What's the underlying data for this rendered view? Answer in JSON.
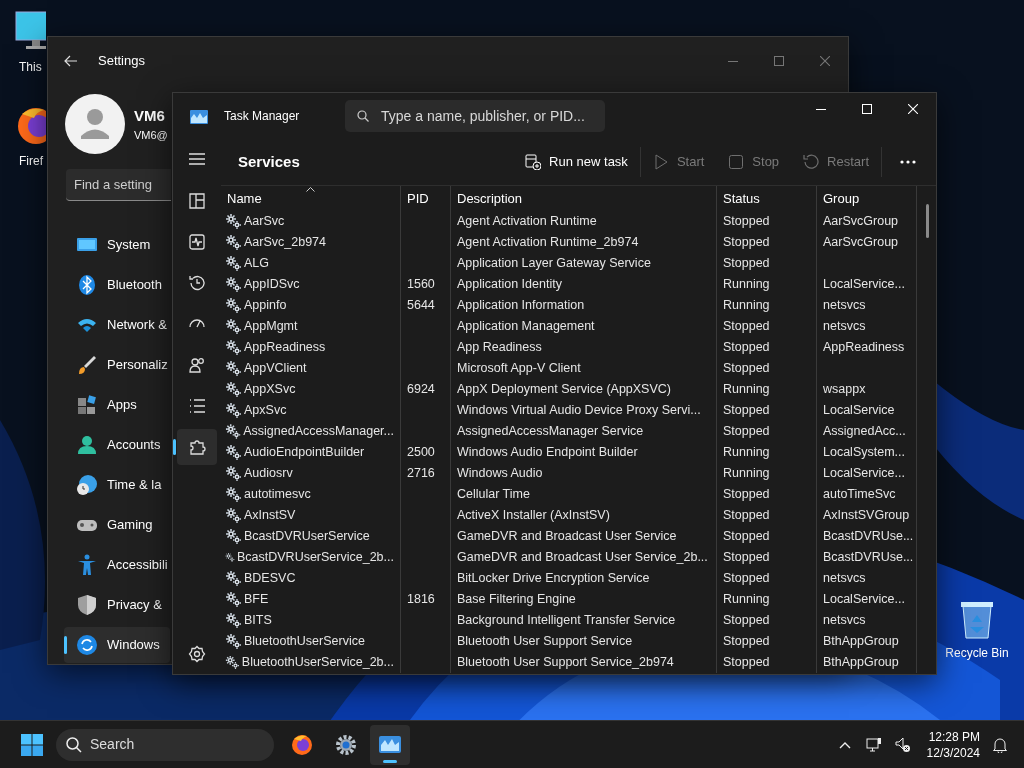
{
  "desktop_icons": [
    {
      "kind": "pc",
      "label": "This"
    },
    {
      "kind": "firefox",
      "label": "Firef"
    },
    {
      "kind": "recycle",
      "label": "Recycle Bin"
    }
  ],
  "settings": {
    "title": "Settings",
    "user": {
      "name": "VM6",
      "email": "VM6@"
    },
    "search": {
      "placeholder": "Find a setting"
    },
    "nav": [
      {
        "kind": "system",
        "label": "System",
        "selected": false
      },
      {
        "kind": "bluetooth",
        "label": "Bluetooth",
        "selected": false
      },
      {
        "kind": "network",
        "label": "Network &",
        "selected": false
      },
      {
        "kind": "personalization",
        "label": "Personaliz",
        "selected": false
      },
      {
        "kind": "apps",
        "label": "Apps",
        "selected": false
      },
      {
        "kind": "accounts",
        "label": "Accounts",
        "selected": false
      },
      {
        "kind": "time",
        "label": "Time & la",
        "selected": false
      },
      {
        "kind": "gaming",
        "label": "Gaming",
        "selected": false
      },
      {
        "kind": "accessibility",
        "label": "Accessibili",
        "selected": false
      },
      {
        "kind": "privacy",
        "label": "Privacy &",
        "selected": false
      },
      {
        "kind": "update",
        "label": "Windows",
        "selected": true
      }
    ]
  },
  "task_manager": {
    "title": "Task Manager",
    "search": {
      "placeholder": "Type a name, publisher, or PID..."
    },
    "page_title": "Services",
    "nav": [
      {
        "kind": "processes",
        "selected": false
      },
      {
        "kind": "performance",
        "selected": false
      },
      {
        "kind": "history",
        "selected": false
      },
      {
        "kind": "startup",
        "selected": false
      },
      {
        "kind": "users",
        "selected": false
      },
      {
        "kind": "details",
        "selected": false
      },
      {
        "kind": "services",
        "selected": true
      }
    ],
    "toolbar": [
      {
        "kind": "run",
        "label": "Run new task",
        "disabled": false
      },
      {
        "kind": "start",
        "label": "Start",
        "disabled": true
      },
      {
        "kind": "stop",
        "label": "Stop",
        "disabled": true
      },
      {
        "kind": "restart",
        "label": "Restart",
        "disabled": true
      }
    ],
    "columns": [
      {
        "label": "Name",
        "sorted": true
      },
      {
        "label": "PID",
        "sorted": false
      },
      {
        "label": "Description",
        "sorted": false
      },
      {
        "label": "Status",
        "sorted": false
      },
      {
        "label": "Group",
        "sorted": false
      }
    ],
    "rows": [
      [
        "AarSvc",
        "",
        "Agent Activation Runtime",
        "Stopped",
        "AarSvcGroup"
      ],
      [
        "AarSvc_2b974",
        "",
        "Agent Activation Runtime_2b974",
        "Stopped",
        "AarSvcGroup"
      ],
      [
        "ALG",
        "",
        "Application Layer Gateway Service",
        "Stopped",
        ""
      ],
      [
        "AppIDSvc",
        "1560",
        "Application Identity",
        "Running",
        "LocalService..."
      ],
      [
        "Appinfo",
        "5644",
        "Application Information",
        "Running",
        "netsvcs"
      ],
      [
        "AppMgmt",
        "",
        "Application Management",
        "Stopped",
        "netsvcs"
      ],
      [
        "AppReadiness",
        "",
        "App Readiness",
        "Stopped",
        "AppReadiness"
      ],
      [
        "AppVClient",
        "",
        "Microsoft App-V Client",
        "Stopped",
        ""
      ],
      [
        "AppXSvc",
        "6924",
        "AppX Deployment Service (AppXSVC)",
        "Running",
        "wsappx"
      ],
      [
        "ApxSvc",
        "",
        "Windows Virtual Audio Device Proxy Servi...",
        "Stopped",
        "LocalService"
      ],
      [
        "AssignedAccessManager...",
        "",
        "AssignedAccessManager Service",
        "Stopped",
        "AssignedAcc..."
      ],
      [
        "AudioEndpointBuilder",
        "2500",
        "Windows Audio Endpoint Builder",
        "Running",
        "LocalSystem..."
      ],
      [
        "Audiosrv",
        "2716",
        "Windows Audio",
        "Running",
        "LocalService..."
      ],
      [
        "autotimesvc",
        "",
        "Cellular Time",
        "Stopped",
        "autoTimeSvc"
      ],
      [
        "AxInstSV",
        "",
        "ActiveX Installer (AxInstSV)",
        "Stopped",
        "AxInstSVGroup"
      ],
      [
        "BcastDVRUserService",
        "",
        "GameDVR and Broadcast User Service",
        "Stopped",
        "BcastDVRUse..."
      ],
      [
        "BcastDVRUserService_2b...",
        "",
        "GameDVR and Broadcast User Service_2b...",
        "Stopped",
        "BcastDVRUse..."
      ],
      [
        "BDESVC",
        "",
        "BitLocker Drive Encryption Service",
        "Stopped",
        "netsvcs"
      ],
      [
        "BFE",
        "1816",
        "Base Filtering Engine",
        "Running",
        "LocalService..."
      ],
      [
        "BITS",
        "",
        "Background Intelligent Transfer Service",
        "Stopped",
        "netsvcs"
      ],
      [
        "BluetoothUserService",
        "",
        "Bluetooth User Support Service",
        "Stopped",
        "BthAppGroup"
      ],
      [
        "BluetoothUserService_2b...",
        "",
        "Bluetooth User Support Service_2b974",
        "Stopped",
        "BthAppGroup"
      ]
    ]
  },
  "taskbar": {
    "search_label": "Search",
    "apps": [
      {
        "kind": "firefox",
        "active": false
      },
      {
        "kind": "settings",
        "active": false
      },
      {
        "kind": "taskmanager",
        "active": true
      }
    ],
    "time": "12:28 PM",
    "date": "12/3/2024"
  }
}
